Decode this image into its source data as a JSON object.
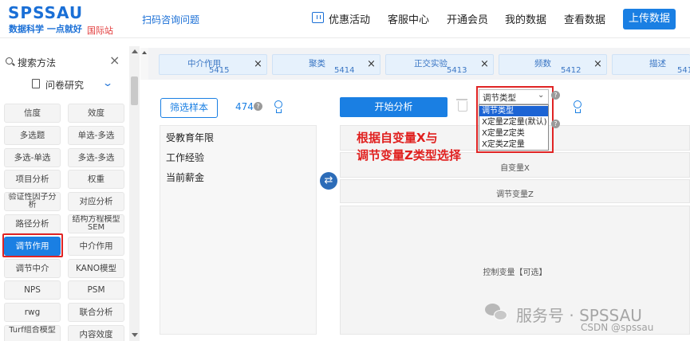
{
  "header": {
    "brand": "SPSSAU",
    "slogan": "数据科学 一点就好",
    "intl": "国际站",
    "scan_link": "扫码咨询问题",
    "nav": [
      "优惠活动",
      "客服中心",
      "开通会员",
      "我的数据",
      "查看数据"
    ],
    "upload_label": "上传数据"
  },
  "sidebar": {
    "search_label": "搜索方法",
    "close": "×",
    "survey_label": "问卷研究",
    "buttons": [
      [
        "信度",
        "效度"
      ],
      [
        "多选题",
        "单选-多选"
      ],
      [
        "多选-单选",
        "多选-多选"
      ],
      [
        "项目分析",
        "权重"
      ],
      [
        "验证性因子分析",
        "对应分析"
      ],
      [
        "路径分析",
        "结构方程模型SEM"
      ],
      [
        "调节作用",
        "中介作用"
      ],
      [
        "调节中介",
        "KANO模型"
      ],
      [
        "NPS",
        "PSM"
      ],
      [
        "rwg",
        "联合分析"
      ],
      [
        "Turf组合模型",
        "内容效度"
      ]
    ],
    "active": "调节作用"
  },
  "tabs": [
    {
      "name": "中介作用",
      "num": "5415"
    },
    {
      "name": "聚类",
      "num": "5414"
    },
    {
      "name": "正交实验",
      "num": "5413"
    },
    {
      "name": "频数",
      "num": "5412"
    },
    {
      "name": "描述",
      "num": "5411"
    }
  ],
  "main": {
    "filter_label": "筛选样本",
    "sample_count": "474",
    "help": "?",
    "variables": [
      "受教育年限",
      "工作经验",
      "当前薪金"
    ],
    "swap": "⇄",
    "start_label": "开始分析",
    "dropdown": {
      "current": "调节类型",
      "options": [
        "调节类型",
        "X定量Z定量(默认)",
        "X定量Z定类",
        "X定类Z定量"
      ],
      "selected_index": 0
    },
    "annotation_line1": "根据自变量X与",
    "annotation_line2": "调节变量Z类型选择",
    "zones": [
      "自变量X",
      "调节变量Z",
      "控制变量【可选】"
    ]
  },
  "watermark": {
    "text": "服务号 · SPSSAU",
    "csdn": "CSDN @spssau"
  },
  "colors": {
    "accent": "#1a7fe3",
    "highlight": "#e02424"
  }
}
